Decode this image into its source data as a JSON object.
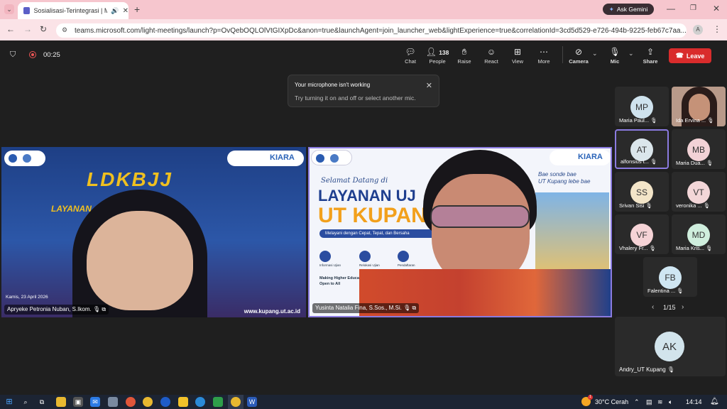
{
  "browser": {
    "tab_title": "Sosialisasi-Terintegrasi | Mic",
    "url": "teams.microsoft.com/light-meetings/launch?p=OvQebOQLOlVtGIXpDc&anon=true&launchAgent=join_launcher_web&lightExperience=true&correlationId=3cd5d529-e726-494b-9225-feb67c7aa...",
    "gemini_label": "Ask Gemini",
    "profile_initial": "A"
  },
  "meeting": {
    "timer": "00:25",
    "people_count": "138",
    "toolbar": {
      "chat": "Chat",
      "people": "People",
      "raise": "Raise",
      "react": "React",
      "view": "View",
      "more": "More",
      "camera": "Camera",
      "mic": "Mic",
      "share": "Share",
      "leave": "Leave"
    }
  },
  "toast": {
    "title": "Your microphone isn't working",
    "body": "Try turning it on and off or select another mic."
  },
  "videos": [
    {
      "name": "Apryeke Petronia Nuban, S.Ikom.",
      "banner_title": "LDKBJJ",
      "banner_sub": "LAYANAN ... SUKSESAN ... UH",
      "date": "Kamis, 23 April 2026",
      "site": "www.kupang.ut.ac.id",
      "brand": "KIARA"
    },
    {
      "name": "Yusinta Natalia Fina, S.Sos., M.Si.",
      "welcome": "Selamat Datang di",
      "title1": "LAYANAN UJ",
      "title2": "UT KUPAN",
      "tagline": "Melayani dengan Cepat, Tepat, dan Bersaha",
      "script_line1": "Bae sonde bae",
      "script_line2": "UT Kupang lebe bae",
      "icons": [
        "Informasi Ujian",
        "Relokasi Ujian",
        "Pendaftaran"
      ],
      "motto1": "Making Higher Education",
      "motto2": "Open to All",
      "brand": "KIARA"
    }
  ],
  "participants": [
    {
      "initials": "MP",
      "name": "Maria Paul...",
      "color": "#cfe3ee"
    },
    {
      "initials": "",
      "name": "Ida Ervina ...",
      "color": "#c9a38c"
    },
    {
      "initials": "AT",
      "name": "alfonsius t...",
      "color": "#dbe6eb"
    },
    {
      "initials": "MB",
      "name": "Maria Dua...",
      "color": "#f2d2d6"
    },
    {
      "initials": "SS",
      "name": "Srivan Sisi",
      "color": "#f3e5c8"
    },
    {
      "initials": "VT",
      "name": "veronika ...",
      "color": "#f3d6d8"
    },
    {
      "initials": "VF",
      "name": "Vhalery Fr...",
      "color": "#f5d3d6"
    },
    {
      "initials": "MD",
      "name": "Maria Kris...",
      "color": "#cfeedd"
    },
    {
      "initials": "FB",
      "name": "Falentina ...",
      "color": "#cfe6f2"
    }
  ],
  "pagination": "1/15",
  "spotlight": {
    "initials": "AK",
    "name": "Andry_UT Kupang",
    "color": "#d2e4ec"
  },
  "taskbar": {
    "weather": "30°C",
    "weather_text": "Cerah",
    "time": "14:14",
    "weather_badge": "1"
  }
}
